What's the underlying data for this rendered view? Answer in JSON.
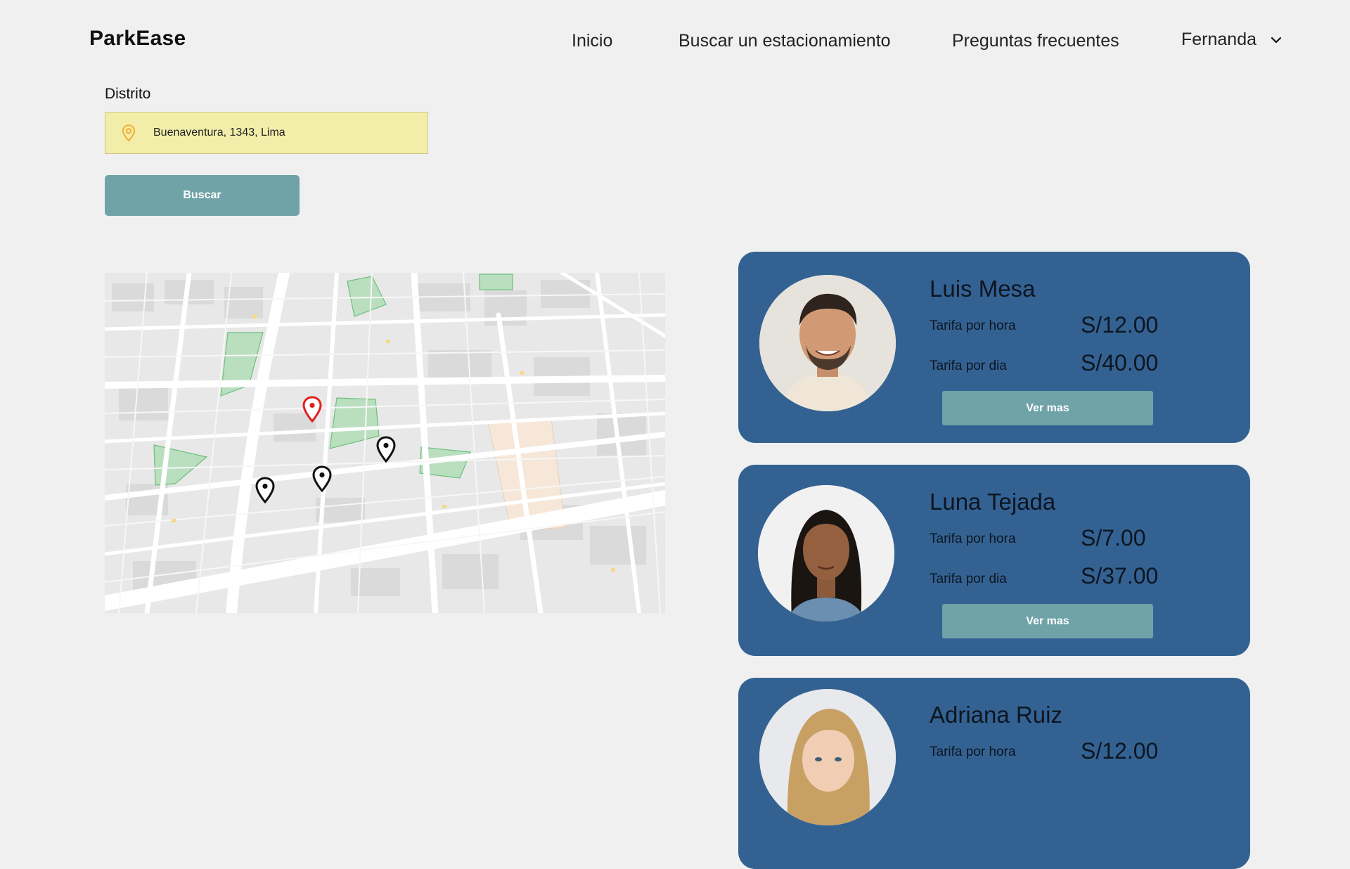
{
  "brand": "ParkEase",
  "nav": {
    "links": [
      "Inicio",
      "Buscar un estacionamiento",
      "Preguntas frecuentes"
    ],
    "user": "Fernanda"
  },
  "search": {
    "label": "Distrito",
    "value": "Buenaventura, 1343, Lima",
    "button": "Buscar"
  },
  "colors": {
    "background": "#f0f0f0",
    "card": "#336292",
    "button": "#6fa3a8",
    "input": "#f2eeaa",
    "selected_pin": "#e02020",
    "pin": "#111111"
  },
  "map": {
    "pins": [
      "selected-pin",
      "pin",
      "pin",
      "pin"
    ]
  },
  "rate_labels": {
    "hour": "Tarifa por hora",
    "day": "Tarifa por dia"
  },
  "cards": [
    {
      "name": "Luis Mesa",
      "hourly": "S/12.00",
      "daily": "S/40.00",
      "button": "Ver mas"
    },
    {
      "name": "Luna Tejada",
      "hourly": "S/7.00",
      "daily": "S/37.00",
      "button": "Ver mas"
    },
    {
      "name": "Adriana Ruiz",
      "hourly": "S/12.00",
      "daily": "",
      "button": ""
    }
  ]
}
